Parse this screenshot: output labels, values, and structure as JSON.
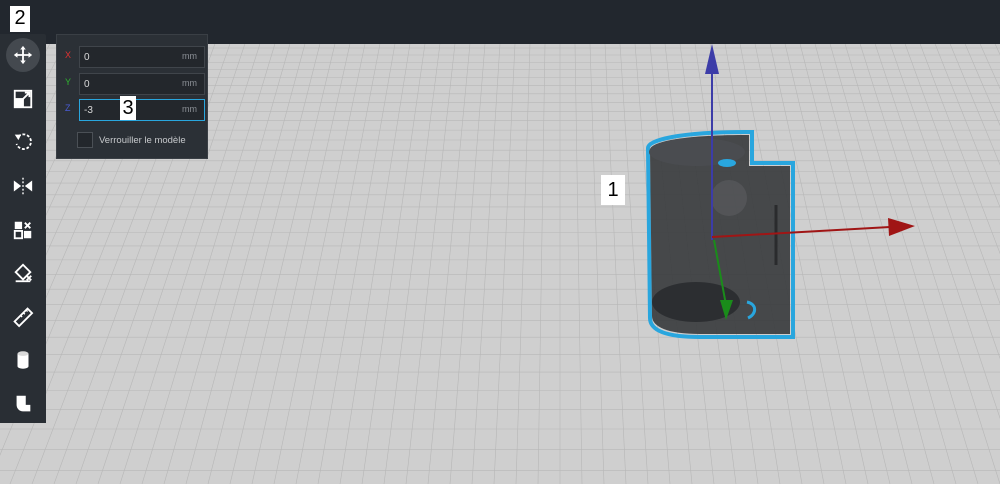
{
  "toolbar": {
    "tools": [
      {
        "name": "move-tool",
        "icon": "move-arrows-icon",
        "active": true
      },
      {
        "name": "scale-tool",
        "icon": "scale-icon"
      },
      {
        "name": "rotate-tool",
        "icon": "rotate-icon"
      },
      {
        "name": "mirror-tool",
        "icon": "mirror-icon"
      },
      {
        "name": "per-model-settings-tool",
        "icon": "per-model-settings-icon"
      },
      {
        "name": "support-blocker-tool",
        "icon": "support-blocker-icon"
      },
      {
        "name": "measure-tool",
        "icon": "ruler-icon"
      },
      {
        "name": "cylinder-tool",
        "icon": "cylinder-icon"
      },
      {
        "name": "custom-shape-tool",
        "icon": "custom-shape-icon"
      }
    ]
  },
  "move_panel": {
    "x": {
      "axis": "X",
      "value": "0",
      "unit": "mm",
      "color": "#e03131"
    },
    "y": {
      "axis": "Y",
      "value": "0",
      "unit": "mm",
      "color": "#2fb52f"
    },
    "z": {
      "axis": "Z",
      "value": "-3",
      "unit": "mm",
      "color": "#4a5cd6"
    },
    "lock_model_label": "Verrouiller le modèle",
    "accent": "#29a6de"
  },
  "callouts": {
    "model": "1",
    "move_tool": "2",
    "z_field": "3"
  },
  "colors": {
    "build_plate": "#cfcfcf",
    "grid_line": "#b9b9b9",
    "selection_outline": "#29a6de",
    "model_fill": "#3b3d40",
    "gizmo_x": "#a01515",
    "gizmo_y": "#1a8c1a",
    "gizmo_z": "#3c3ca8"
  }
}
